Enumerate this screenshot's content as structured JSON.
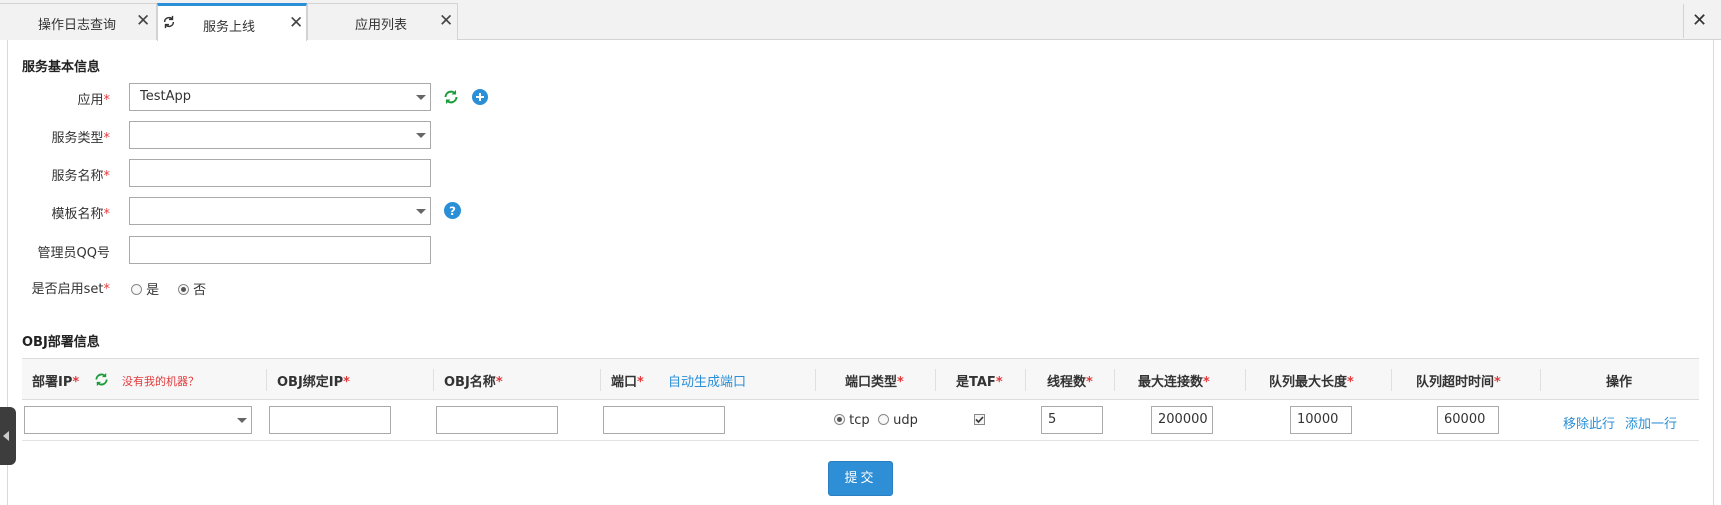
{
  "tabs": [
    {
      "label": "操作日志查询",
      "close": "✕"
    },
    {
      "label": "服务上线",
      "close": "✕"
    },
    {
      "label": "应用列表",
      "close": "✕"
    }
  ],
  "window_close": "✕",
  "basic": {
    "title": "服务基本信息",
    "required_mark": "*",
    "app_label": "应用",
    "app_value": "TestApp",
    "service_type_label": "服务类型",
    "service_name_label": "服务名称",
    "template_label": "模板名称",
    "admin_qq_label": "管理员QQ号",
    "enable_set_label": "是否启用set",
    "enable_set_yes": "是",
    "enable_set_no": "否",
    "enable_set_selected": "否"
  },
  "obj": {
    "title": "OBJ部署信息",
    "headers": {
      "deploy_ip": "部署IP",
      "no_machine": "没有我的机器？",
      "obj_bind_ip": "OBJ绑定IP",
      "obj_name": "OBJ名称",
      "port": "端口",
      "auto_port": "自动生成端口",
      "port_type": "端口类型",
      "is_taf": "是TAF",
      "threads": "线程数",
      "max_conn": "最大连接数",
      "queue_max_len": "队列最大长度",
      "queue_timeout": "队列超时时间",
      "actions": "操作"
    },
    "row": {
      "port_type_tcp": "tcp",
      "port_type_udp": "udp",
      "port_type_selected": "tcp",
      "is_taf_checked": true,
      "threads": "5",
      "max_conn": "200000",
      "queue_max_len": "10000",
      "queue_timeout": "60000",
      "remove_row": "移除此行",
      "add_row": "添加一行"
    }
  },
  "submit_label": "提交",
  "colors": {
    "accent": "#2a8fd6",
    "required": "#e4393c",
    "refresh_green": "#1a9c3a"
  }
}
